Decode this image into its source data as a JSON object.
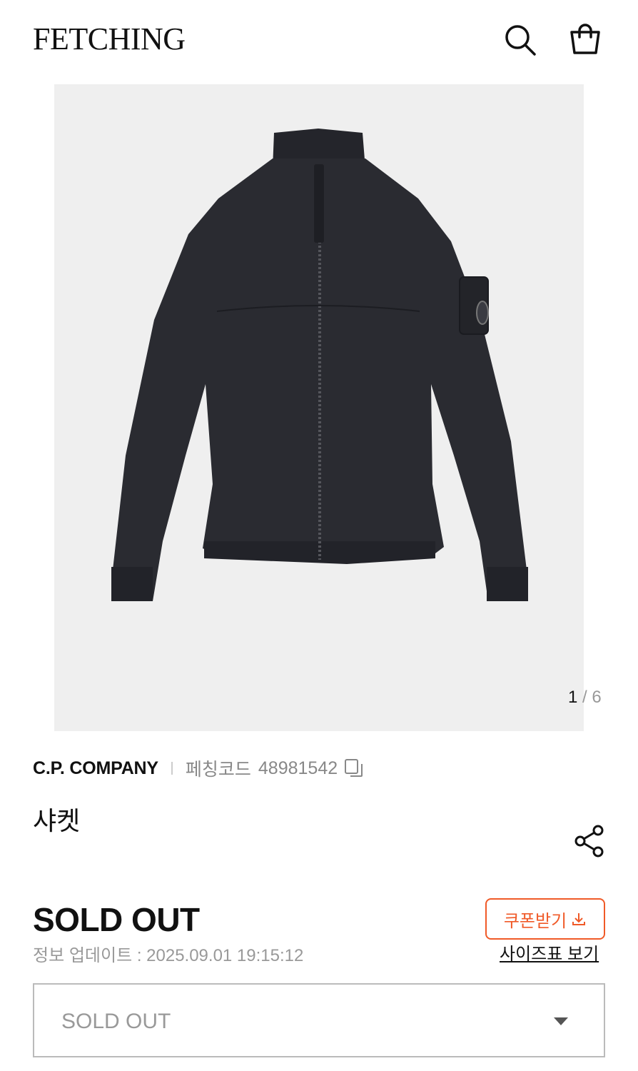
{
  "header": {
    "logo": "FETCHING",
    "icons": {
      "search": "search-icon",
      "bag": "shopping-bag-icon"
    }
  },
  "gallery": {
    "current": "1",
    "separator": " / ",
    "total": "6",
    "image": "black-zip-jacket-photo"
  },
  "product": {
    "brand": "C.P. COMPANY",
    "code_label": "페칭코드",
    "code": "48981542",
    "name": "샤켓",
    "status": "SOLD OUT",
    "updated": "정보 업데이트 : 2025.09.01 19:15:12"
  },
  "actions": {
    "coupon_label": "쿠폰받기",
    "size_chart_label": "사이즈표 보기"
  },
  "select": {
    "value": "SOLD OUT"
  },
  "colors": {
    "accent": "#f05a28",
    "text": "#111111",
    "muted": "#999999",
    "image_bg": "#efefef"
  }
}
